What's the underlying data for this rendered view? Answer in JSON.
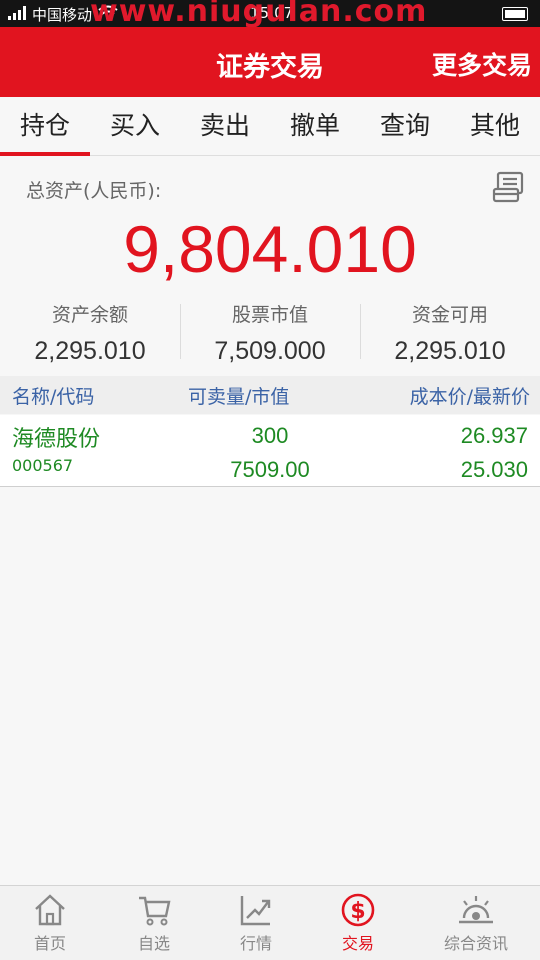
{
  "status_bar": {
    "carrier": "中国移动",
    "time": "15:07",
    "watermark": "www.niugulan.com"
  },
  "header": {
    "title": "证券交易",
    "more": "更多交易"
  },
  "tabs": [
    {
      "label": "持仓",
      "active": true
    },
    {
      "label": "买入",
      "active": false
    },
    {
      "label": "卖出",
      "active": false
    },
    {
      "label": "撤单",
      "active": false
    },
    {
      "label": "查询",
      "active": false
    },
    {
      "label": "其他",
      "active": false
    }
  ],
  "assets": {
    "total_label": "总资产(人民币):",
    "total_value": "9,804.010",
    "stats": [
      {
        "label": "资产余额",
        "value": "2,295.010"
      },
      {
        "label": "股票市值",
        "value": "7,509.000"
      },
      {
        "label": "资金可用",
        "value": "2,295.010"
      }
    ]
  },
  "positions": {
    "headers": [
      "名称/代码",
      "可卖量/市值",
      "成本价/最新价"
    ],
    "rows": [
      {
        "name": "海德股份",
        "code": "000567",
        "sellable": "300",
        "market_value": "7509.00",
        "cost": "26.937",
        "latest": "25.030"
      }
    ]
  },
  "bottom_nav": [
    {
      "label": "首页",
      "icon": "home-icon",
      "active": false
    },
    {
      "label": "自选",
      "icon": "cart-icon",
      "active": false
    },
    {
      "label": "行情",
      "icon": "chart-icon",
      "active": false
    },
    {
      "label": "交易",
      "icon": "dollar-icon",
      "active": true
    },
    {
      "label": "综合资讯",
      "icon": "sunrise-icon",
      "active": false
    }
  ],
  "colors": {
    "brand_red": "#e1141f",
    "position_green": "#1e8a23",
    "header_blue": "#3b63a6"
  }
}
